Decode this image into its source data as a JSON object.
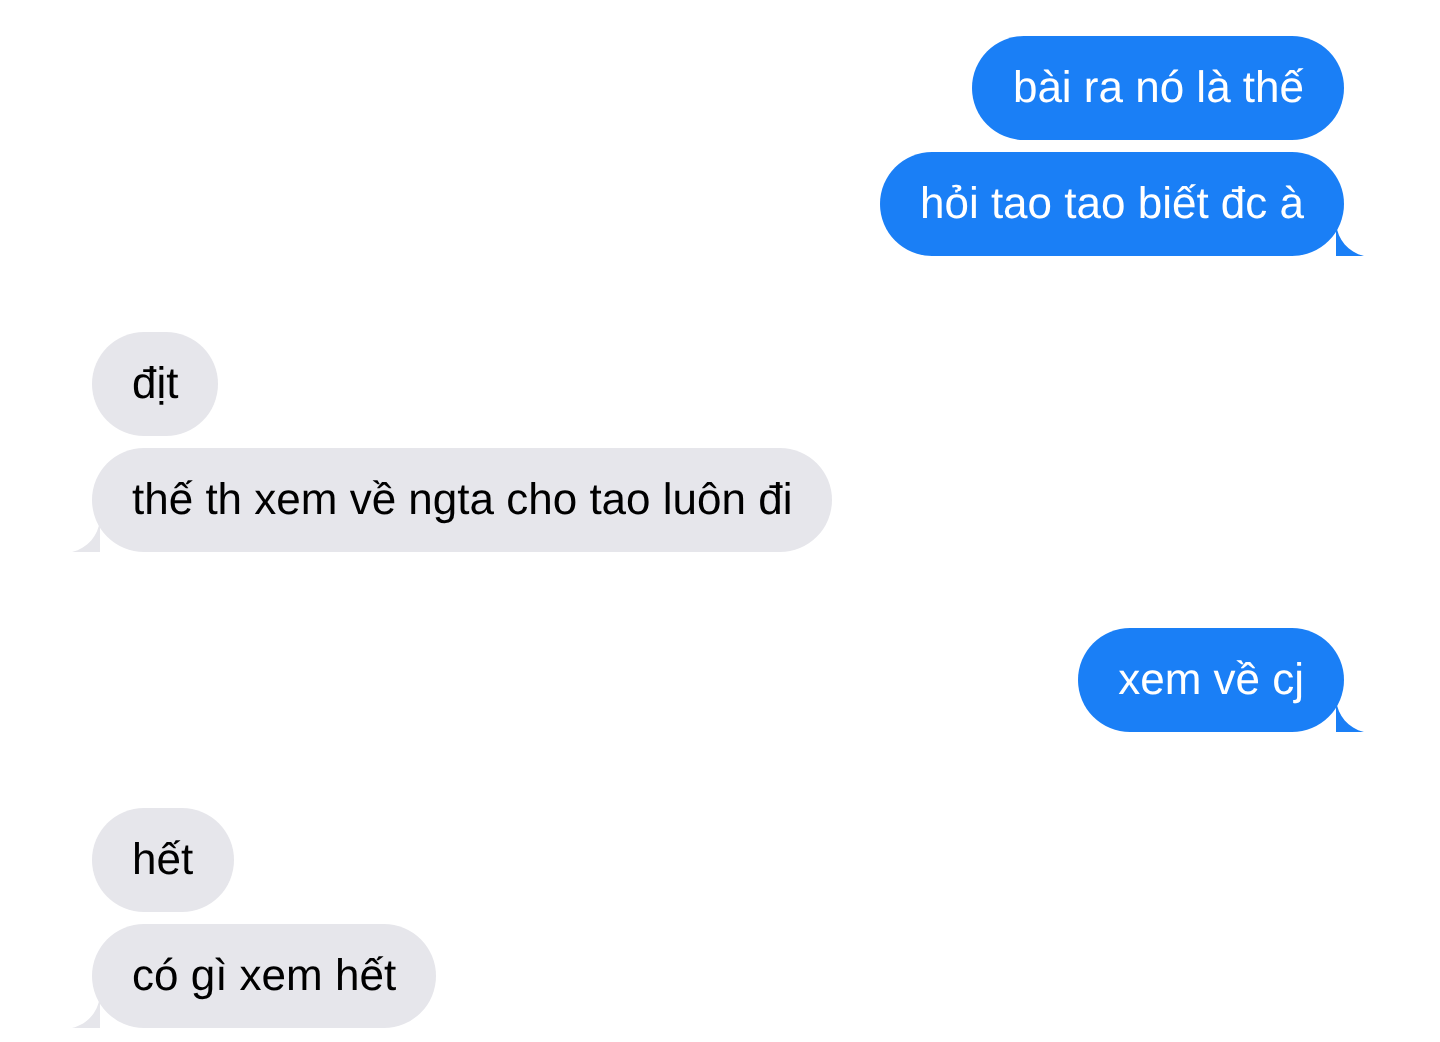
{
  "messages": [
    {
      "kind": "sent",
      "text": "bài ra nó là thế",
      "tail": false
    },
    {
      "kind": "sent",
      "text": "hỏi tao tao biết đc à",
      "tail": true
    },
    {
      "kind": "received",
      "text": "địt",
      "tail": false
    },
    {
      "kind": "received",
      "text": "thế th xem về ngta cho tao luôn đi",
      "tail": true
    },
    {
      "kind": "sent",
      "text": "xem về cj",
      "tail": true
    },
    {
      "kind": "received",
      "text": "hết",
      "tail": false
    },
    {
      "kind": "received",
      "text": "có gì xem hết",
      "tail": true
    }
  ]
}
